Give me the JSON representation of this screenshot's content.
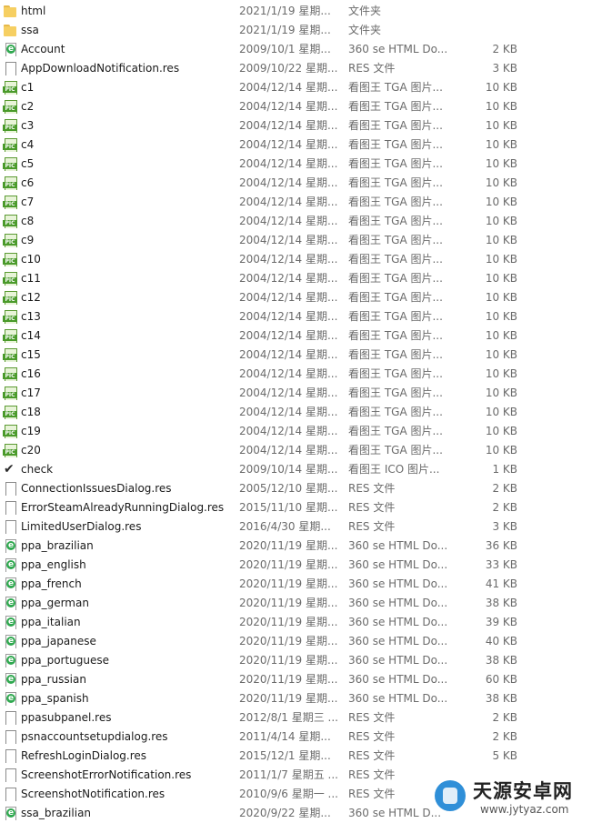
{
  "rows": [
    {
      "name": "html",
      "date": "2021/1/19 星期...",
      "type": "文件夹",
      "size": "",
      "icon": "folder-icon"
    },
    {
      "name": "ssa",
      "date": "2021/1/19 星期...",
      "type": "文件夹",
      "size": "",
      "icon": "folder-icon"
    },
    {
      "name": "Account",
      "date": "2009/10/1 星期...",
      "type": "360 se HTML Do...",
      "size": "2 KB",
      "icon": "html-file-icon"
    },
    {
      "name": "AppDownloadNotification.res",
      "date": "2009/10/22 星期...",
      "type": "RES 文件",
      "size": "3 KB",
      "icon": "file-icon"
    },
    {
      "name": "c1",
      "date": "2004/12/14 星期...",
      "type": "看图王 TGA 图片...",
      "size": "10 KB",
      "icon": "tga-image-icon"
    },
    {
      "name": "c2",
      "date": "2004/12/14 星期...",
      "type": "看图王 TGA 图片...",
      "size": "10 KB",
      "icon": "tga-image-icon"
    },
    {
      "name": "c3",
      "date": "2004/12/14 星期...",
      "type": "看图王 TGA 图片...",
      "size": "10 KB",
      "icon": "tga-image-icon"
    },
    {
      "name": "c4",
      "date": "2004/12/14 星期...",
      "type": "看图王 TGA 图片...",
      "size": "10 KB",
      "icon": "tga-image-icon"
    },
    {
      "name": "c5",
      "date": "2004/12/14 星期...",
      "type": "看图王 TGA 图片...",
      "size": "10 KB",
      "icon": "tga-image-icon"
    },
    {
      "name": "c6",
      "date": "2004/12/14 星期...",
      "type": "看图王 TGA 图片...",
      "size": "10 KB",
      "icon": "tga-image-icon"
    },
    {
      "name": "c7",
      "date": "2004/12/14 星期...",
      "type": "看图王 TGA 图片...",
      "size": "10 KB",
      "icon": "tga-image-icon"
    },
    {
      "name": "c8",
      "date": "2004/12/14 星期...",
      "type": "看图王 TGA 图片...",
      "size": "10 KB",
      "icon": "tga-image-icon"
    },
    {
      "name": "c9",
      "date": "2004/12/14 星期...",
      "type": "看图王 TGA 图片...",
      "size": "10 KB",
      "icon": "tga-image-icon"
    },
    {
      "name": "c10",
      "date": "2004/12/14 星期...",
      "type": "看图王 TGA 图片...",
      "size": "10 KB",
      "icon": "tga-image-icon"
    },
    {
      "name": "c11",
      "date": "2004/12/14 星期...",
      "type": "看图王 TGA 图片...",
      "size": "10 KB",
      "icon": "tga-image-icon"
    },
    {
      "name": "c12",
      "date": "2004/12/14 星期...",
      "type": "看图王 TGA 图片...",
      "size": "10 KB",
      "icon": "tga-image-icon"
    },
    {
      "name": "c13",
      "date": "2004/12/14 星期...",
      "type": "看图王 TGA 图片...",
      "size": "10 KB",
      "icon": "tga-image-icon"
    },
    {
      "name": "c14",
      "date": "2004/12/14 星期...",
      "type": "看图王 TGA 图片...",
      "size": "10 KB",
      "icon": "tga-image-icon"
    },
    {
      "name": "c15",
      "date": "2004/12/14 星期...",
      "type": "看图王 TGA 图片...",
      "size": "10 KB",
      "icon": "tga-image-icon"
    },
    {
      "name": "c16",
      "date": "2004/12/14 星期...",
      "type": "看图王 TGA 图片...",
      "size": "10 KB",
      "icon": "tga-image-icon"
    },
    {
      "name": "c17",
      "date": "2004/12/14 星期...",
      "type": "看图王 TGA 图片...",
      "size": "10 KB",
      "icon": "tga-image-icon"
    },
    {
      "name": "c18",
      "date": "2004/12/14 星期...",
      "type": "看图王 TGA 图片...",
      "size": "10 KB",
      "icon": "tga-image-icon"
    },
    {
      "name": "c19",
      "date": "2004/12/14 星期...",
      "type": "看图王 TGA 图片...",
      "size": "10 KB",
      "icon": "tga-image-icon"
    },
    {
      "name": "c20",
      "date": "2004/12/14 星期...",
      "type": "看图王 TGA 图片...",
      "size": "10 KB",
      "icon": "tga-image-icon"
    },
    {
      "name": "check",
      "date": "2009/10/14 星期...",
      "type": "看图王 ICO 图片...",
      "size": "1 KB",
      "icon": "check-icon"
    },
    {
      "name": "ConnectionIssuesDialog.res",
      "date": "2005/12/10 星期...",
      "type": "RES 文件",
      "size": "2 KB",
      "icon": "file-icon"
    },
    {
      "name": "ErrorSteamAlreadyRunningDialog.res",
      "date": "2015/11/10 星期...",
      "type": "RES 文件",
      "size": "2 KB",
      "icon": "file-icon"
    },
    {
      "name": "LimitedUserDialog.res",
      "date": "2016/4/30 星期...",
      "type": "RES 文件",
      "size": "3 KB",
      "icon": "file-icon"
    },
    {
      "name": "ppa_brazilian",
      "date": "2020/11/19 星期...",
      "type": "360 se HTML Do...",
      "size": "36 KB",
      "icon": "html-file-icon"
    },
    {
      "name": "ppa_english",
      "date": "2020/11/19 星期...",
      "type": "360 se HTML Do...",
      "size": "33 KB",
      "icon": "html-file-icon"
    },
    {
      "name": "ppa_french",
      "date": "2020/11/19 星期...",
      "type": "360 se HTML Do...",
      "size": "41 KB",
      "icon": "html-file-icon"
    },
    {
      "name": "ppa_german",
      "date": "2020/11/19 星期...",
      "type": "360 se HTML Do...",
      "size": "38 KB",
      "icon": "html-file-icon"
    },
    {
      "name": "ppa_italian",
      "date": "2020/11/19 星期...",
      "type": "360 se HTML Do...",
      "size": "39 KB",
      "icon": "html-file-icon"
    },
    {
      "name": "ppa_japanese",
      "date": "2020/11/19 星期...",
      "type": "360 se HTML Do...",
      "size": "40 KB",
      "icon": "html-file-icon"
    },
    {
      "name": "ppa_portuguese",
      "date": "2020/11/19 星期...",
      "type": "360 se HTML Do...",
      "size": "38 KB",
      "icon": "html-file-icon"
    },
    {
      "name": "ppa_russian",
      "date": "2020/11/19 星期...",
      "type": "360 se HTML Do...",
      "size": "60 KB",
      "icon": "html-file-icon"
    },
    {
      "name": "ppa_spanish",
      "date": "2020/11/19 星期...",
      "type": "360 se HTML Do...",
      "size": "38 KB",
      "icon": "html-file-icon"
    },
    {
      "name": "ppasubpanel.res",
      "date": "2012/8/1 星期三 ...",
      "type": "RES 文件",
      "size": "2 KB",
      "icon": "file-icon"
    },
    {
      "name": "psnaccountsetupdialog.res",
      "date": "2011/4/14 星期...",
      "type": "RES 文件",
      "size": "2 KB",
      "icon": "file-icon"
    },
    {
      "name": "RefreshLoginDialog.res",
      "date": "2015/12/1 星期...",
      "type": "RES 文件",
      "size": "5 KB",
      "icon": "file-icon"
    },
    {
      "name": "ScreenshotErrorNotification.res",
      "date": "2011/1/7 星期五 ...",
      "type": "RES 文件",
      "size": "",
      "icon": "file-icon"
    },
    {
      "name": "ScreenshotNotification.res",
      "date": "2010/9/6 星期一 ...",
      "type": "RES 文件",
      "size": "",
      "icon": "file-icon"
    },
    {
      "name": "ssa_brazilian",
      "date": "2020/9/22 星期...",
      "type": "360 se HTML D...",
      "size": "",
      "icon": "html-file-icon"
    }
  ],
  "watermark": {
    "title": "天源安卓网",
    "url": "www.jytyaz.com",
    "icon": "phone-logo-icon"
  }
}
